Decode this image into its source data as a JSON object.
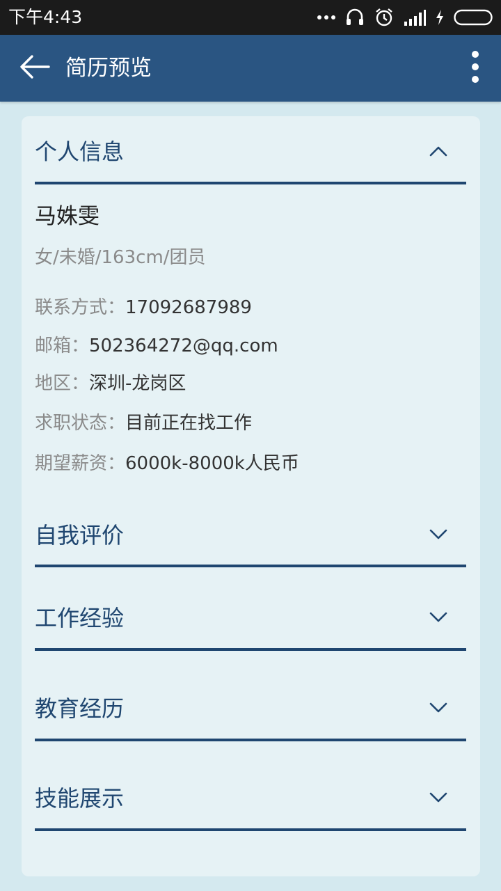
{
  "status_bar": {
    "time": "下午4:43",
    "icons": [
      "more-dots-icon",
      "headset-icon",
      "alarm-icon",
      "signal-icon",
      "charging-icon",
      "battery-icon"
    ]
  },
  "app_bar": {
    "title": "简历预览",
    "back_icon": "arrow-left-icon",
    "menu_icon": "more-vertical-icon"
  },
  "colors": {
    "status_bar_bg": "#1b1b1b",
    "app_bar_bg": "#2a5582",
    "page_bg": "#d4e9ef",
    "card_bg": "#e6f2f5",
    "accent": "#1f4670"
  },
  "sections": [
    {
      "title": "个人信息",
      "expanded": true
    },
    {
      "title": "自我评价",
      "expanded": false
    },
    {
      "title": "工作经验",
      "expanded": false
    },
    {
      "title": "教育经历",
      "expanded": false
    },
    {
      "title": "技能展示",
      "expanded": false
    }
  ],
  "personal": {
    "name": "马姝雯",
    "basic": "女/未婚/163cm/团员",
    "fields": [
      {
        "label": "联系方式：",
        "value": "17092687989"
      },
      {
        "label": "邮箱：",
        "value": "502364272@qq.com"
      },
      {
        "label": "地区：",
        "value": "深圳-龙岗区"
      },
      {
        "label": "求职状态：",
        "value": "目前正在找工作"
      },
      {
        "label": "期望薪资：",
        "value": "6000k-8000k人民币"
      }
    ]
  }
}
